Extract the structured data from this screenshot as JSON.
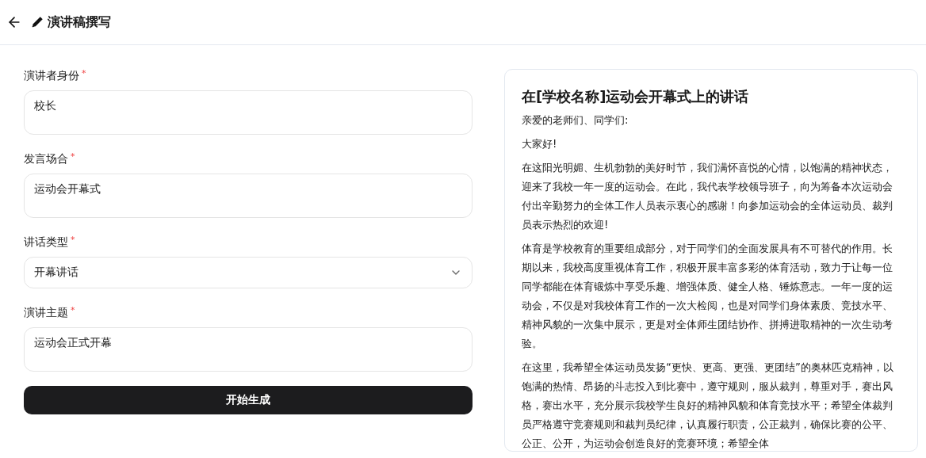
{
  "header": {
    "title": "演讲稿撰写"
  },
  "form": {
    "fields": [
      {
        "kind": "textarea",
        "label": "演讲者身份",
        "required_mark": "*",
        "value": "校长"
      },
      {
        "kind": "textarea",
        "label": "发言场合",
        "required_mark": "*",
        "value": "运动会开幕式"
      },
      {
        "kind": "select",
        "label": "讲话类型",
        "required_mark": "*",
        "value": "开幕讲话"
      },
      {
        "kind": "textarea",
        "label": "演讲主题",
        "required_mark": "*",
        "value": "运动会正式开幕"
      }
    ],
    "submit": "开始生成"
  },
  "result": {
    "title": "在[学校名称]运动会开幕式上的讲话",
    "paragraphs": [
      "亲爱的老师们、同学们:",
      "大家好!",
      "在这阳光明媚、生机勃勃的美好时节，我们满怀喜悦的心情，以饱满的精神状态，迎来了我校一年一度的运动会。在此，我代表学校领导班子，向为筹备本次运动会付出辛勤努力的全体工作人员表示衷心的感谢！向参加运动会的全体运动员、裁判员表示热烈的欢迎!",
      "体育是学校教育的重要组成部分，对于同学们的全面发展具有不可替代的作用。长期以来，我校高度重视体育工作，积极开展丰富多彩的体育活动，致力于让每一位同学都能在体育锻炼中享受乐趣、增强体质、健全人格、锤炼意志。一年一度的运动会，不仅是对我校体育工作的一次大检阅，也是对同学们身体素质、竞技水平、精神风貌的一次集中展示，更是对全体师生团结协作、拼搏进取精神的一次生动考验。",
      "在这里，我希望全体运动员发扬“更快、更高、更强、更团结”的奥林匹克精神，以饱满的热情、昂扬的斗志投入到比赛中，遵守规则，服从裁判，尊重对手，赛出风格，赛出水平，充分展示我校学生良好的精神风貌和体育竞技水平；希望全体裁判员严格遵守竞赛规则和裁判员纪律，认真履行职责，公正裁判，确保比赛的公平、公正、公开，为运动会创造良好的竞赛环境；希望全体"
    ]
  }
}
